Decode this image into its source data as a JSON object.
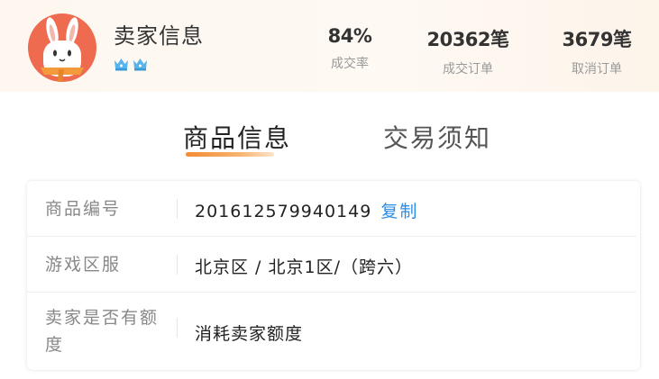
{
  "seller": {
    "title": "卖家信息",
    "avatar_icon": "rabbit-avatar",
    "crown_icon": "crown-icon",
    "crown_count": 2,
    "colors": {
      "avatar_bg": "#ef6b4f",
      "crown": "#5ab4ec"
    }
  },
  "stats": {
    "rate": {
      "value": "84%",
      "label": "成交率"
    },
    "done": {
      "value": "20362笔",
      "label": "成交订单"
    },
    "cancel": {
      "value": "3679笔",
      "label": "取消订单"
    }
  },
  "tabs": {
    "goods": "商品信息",
    "trade": "交易须知",
    "active": "goods",
    "colors": {
      "underline": "#f28b34"
    }
  },
  "info": {
    "rows": [
      {
        "label": "商品编号",
        "value": "201612579940149",
        "action": "复制"
      },
      {
        "label": "游戏区服",
        "value": "北京区 / 北京1区/（跨六）"
      },
      {
        "label_line1": "卖家是否有额",
        "label_line2": "度",
        "value": "消耗卖家额度"
      }
    ],
    "colors": {
      "link": "#2b8ee6"
    }
  }
}
